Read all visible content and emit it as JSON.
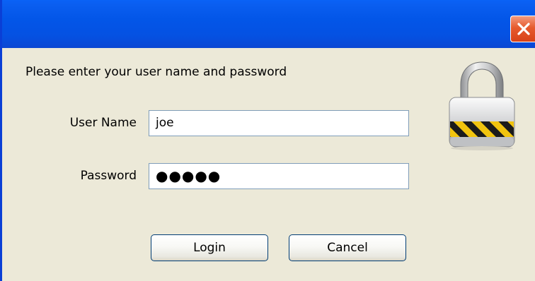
{
  "window": {
    "title": "",
    "close_icon": "close-icon",
    "colors": {
      "titlebar": "#0356e8",
      "close_button": "#e65a2e",
      "dialog_background": "#ece9d8",
      "field_border": "#7f9db9",
      "button_border": "#003c74"
    }
  },
  "dialog": {
    "prompt": "Please enter your user name and password",
    "username": {
      "label": "User Name",
      "value": "joe"
    },
    "password": {
      "label": "Password",
      "value": "●●●●●"
    },
    "icon": "padlock-icon",
    "buttons": {
      "login": "Login",
      "cancel": "Cancel"
    }
  }
}
